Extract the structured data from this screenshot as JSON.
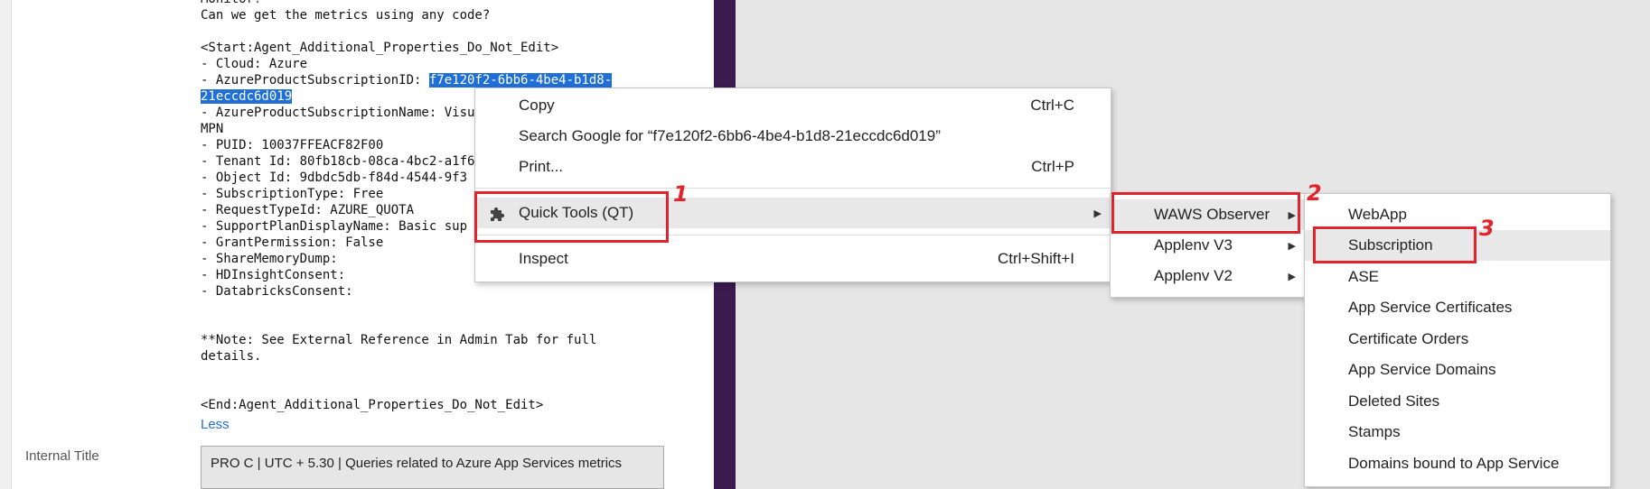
{
  "document": {
    "lines": [
      {
        "text": "Monitor?"
      },
      {
        "text": "Can we get the metrics using any code?"
      },
      {
        "text": ""
      },
      {
        "text": "<Start:Agent_Additional_Properties_Do_Not_Edit>"
      },
      {
        "text": "- Cloud: Azure"
      },
      {
        "text": "- AzureProductSubscriptionID: ",
        "highlight": "f7e120f2-6bb6-4be4-b1d8-"
      },
      {
        "text": "",
        "highlight": "21eccdc6d019"
      },
      {
        "text": "- AzureProductSubscriptionName: Visu"
      },
      {
        "text": "MPN"
      },
      {
        "text": "- PUID: 10037FFEACF82F00"
      },
      {
        "text": "- Tenant Id: 80fb18cb-08ca-4bc2-a1f6"
      },
      {
        "text": "- Object Id: 9dbdc5db-f84d-4544-9f3"
      },
      {
        "text": "- SubscriptionType: Free"
      },
      {
        "text": "- RequestTypeId: AZURE_QUOTA"
      },
      {
        "text": "- SupportPlanDisplayName: Basic sup"
      },
      {
        "text": "- GrantPermission: False"
      },
      {
        "text": "- ShareMemoryDump:"
      },
      {
        "text": "- HDInsightConsent:"
      },
      {
        "text": "- DatabricksConsent:"
      },
      {
        "text": ""
      },
      {
        "text": ""
      },
      {
        "text": "**Note: See External Reference in Admin Tab for full"
      },
      {
        "text": "details."
      },
      {
        "text": ""
      },
      {
        "text": ""
      },
      {
        "text": "<End:Agent_Additional_Properties_Do_Not_Edit>"
      }
    ],
    "less_link": "Less",
    "internal_title_label": "Internal Title",
    "internal_title_value": "PRO C | UTC + 5.30 | Queries related to Azure App Services metrics"
  },
  "context_menu": {
    "copy_label": "Copy",
    "copy_shortcut": "Ctrl+C",
    "search_label": "Search Google for “f7e120f2-6bb6-4be4-b1d8-21eccdc6d019”",
    "print_label": "Print...",
    "print_shortcut": "Ctrl+P",
    "quick_tools_label": "Quick Tools (QT)",
    "inspect_label": "Inspect",
    "inspect_shortcut": "Ctrl+Shift+I",
    "icon": "puzzle-piece-icon"
  },
  "qt_submenu": {
    "items": [
      "WAWS Observer",
      "Applenv V3",
      "Applenv V2"
    ]
  },
  "waws_submenu": {
    "items": [
      "WebApp",
      "Subscription",
      "ASE",
      "App Service Certificates",
      "Certificate Orders",
      "App Service Domains",
      "Deleted Sites",
      "Stamps",
      "Domains bound to App Service"
    ]
  },
  "annotations": {
    "step1": "1",
    "step2": "2",
    "step3": "3",
    "color": "#e3232b"
  },
  "colors": {
    "highlight": "#1f6fd6",
    "purple_bar": "#3b1a4d",
    "link": "#1f6fd6"
  }
}
